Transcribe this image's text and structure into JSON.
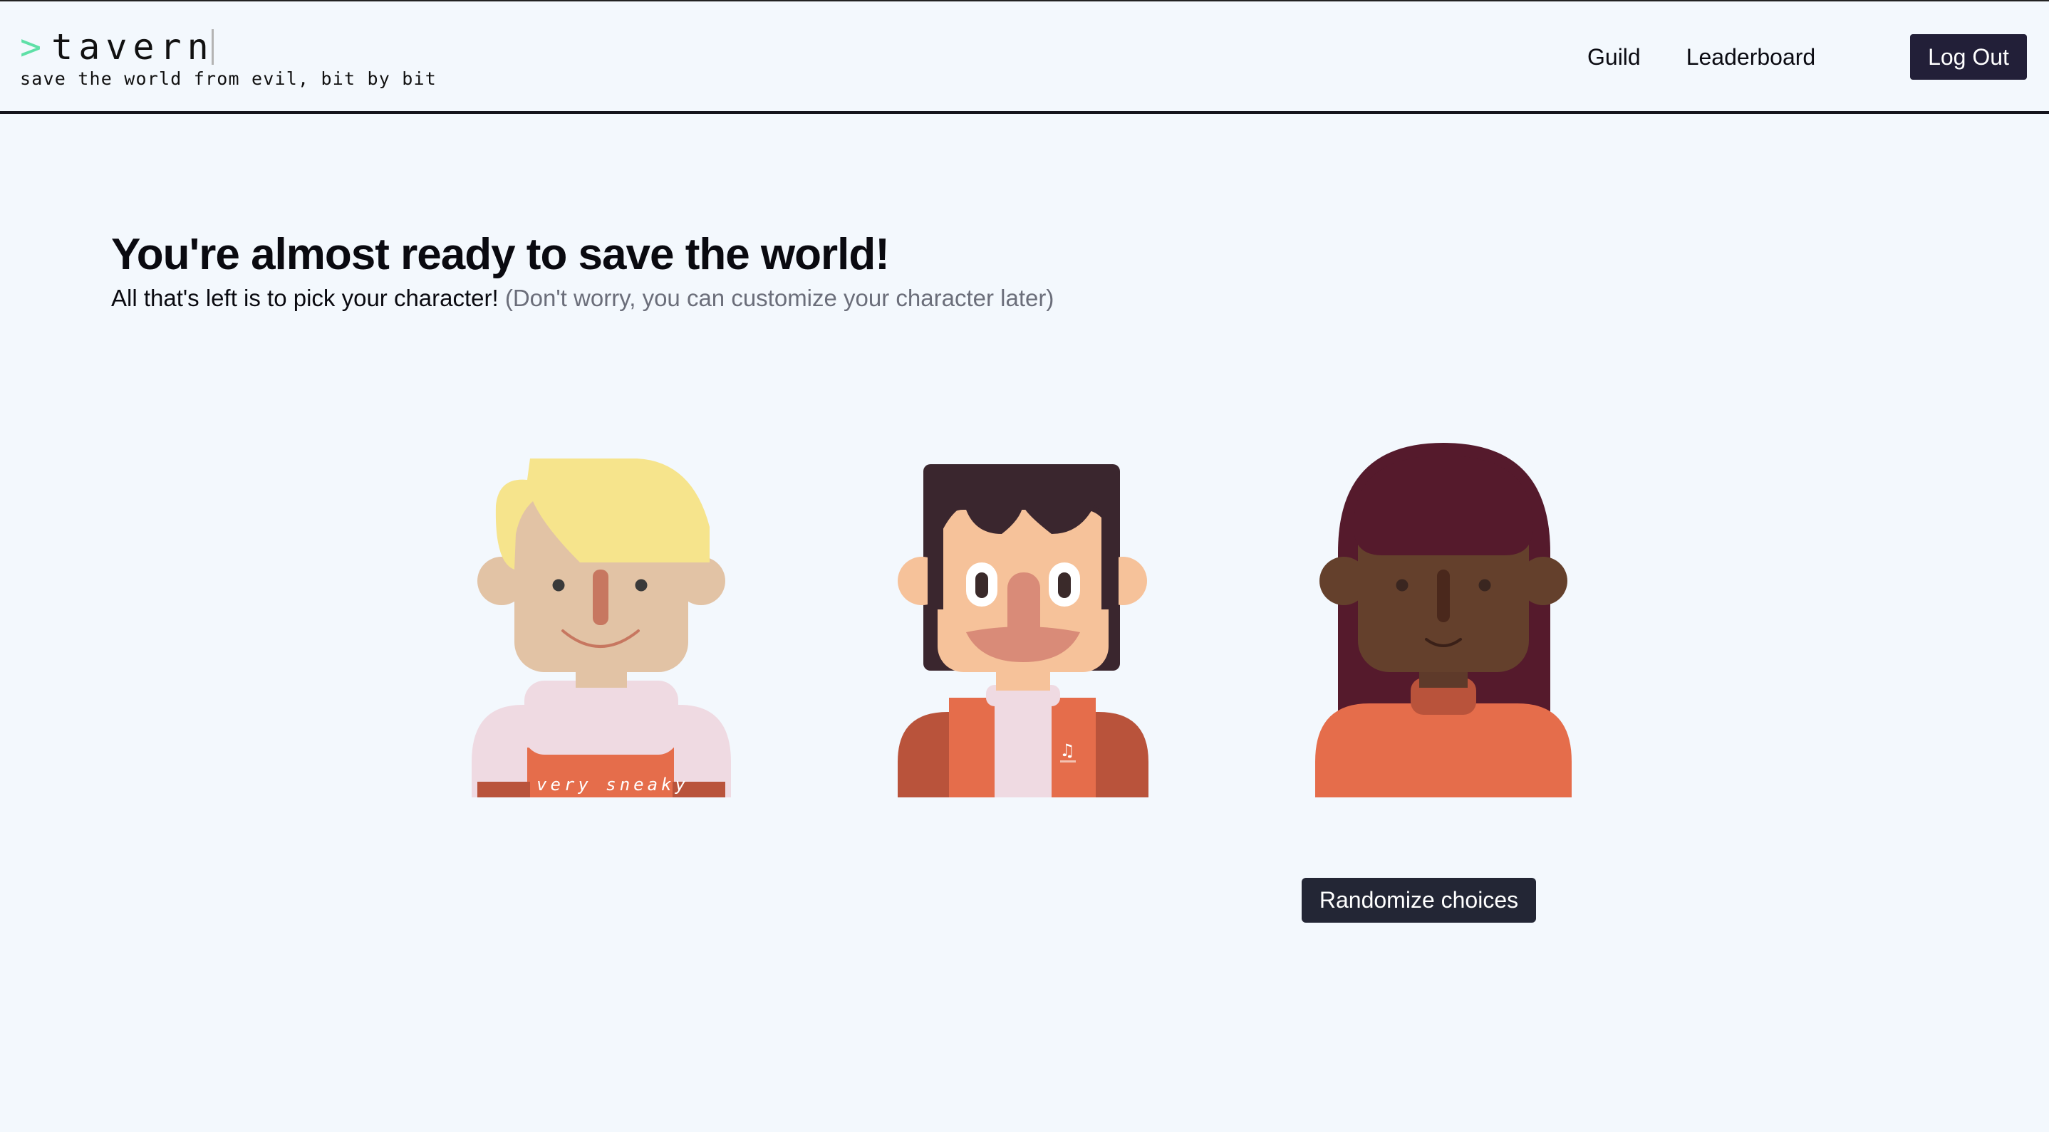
{
  "header": {
    "logo_prompt": ">",
    "logo_text": "tavern",
    "tagline": "save the world from evil, bit by bit",
    "nav": {
      "guild": "Guild",
      "leaderboard": "Leaderboard"
    },
    "logout_label": "Log Out"
  },
  "main": {
    "title": "You're almost ready to save the world!",
    "subtitle": "All that's left is to pick your character!",
    "subtitle_note": "(Don't worry, you can customize your character later)",
    "characters": [
      {
        "shirt_text": "very sneaky"
      },
      {
        "shirt_text": "♫"
      },
      {
        "shirt_text": ""
      }
    ],
    "randomize_label": "Randomize choices"
  },
  "colors": {
    "background": "#f3f8fd",
    "button_dark": "#221f38",
    "accent_prompt": "#5ee0a7",
    "shirt_orange": "#e56d4b",
    "shirt_orange_dark": "#b9533b"
  }
}
